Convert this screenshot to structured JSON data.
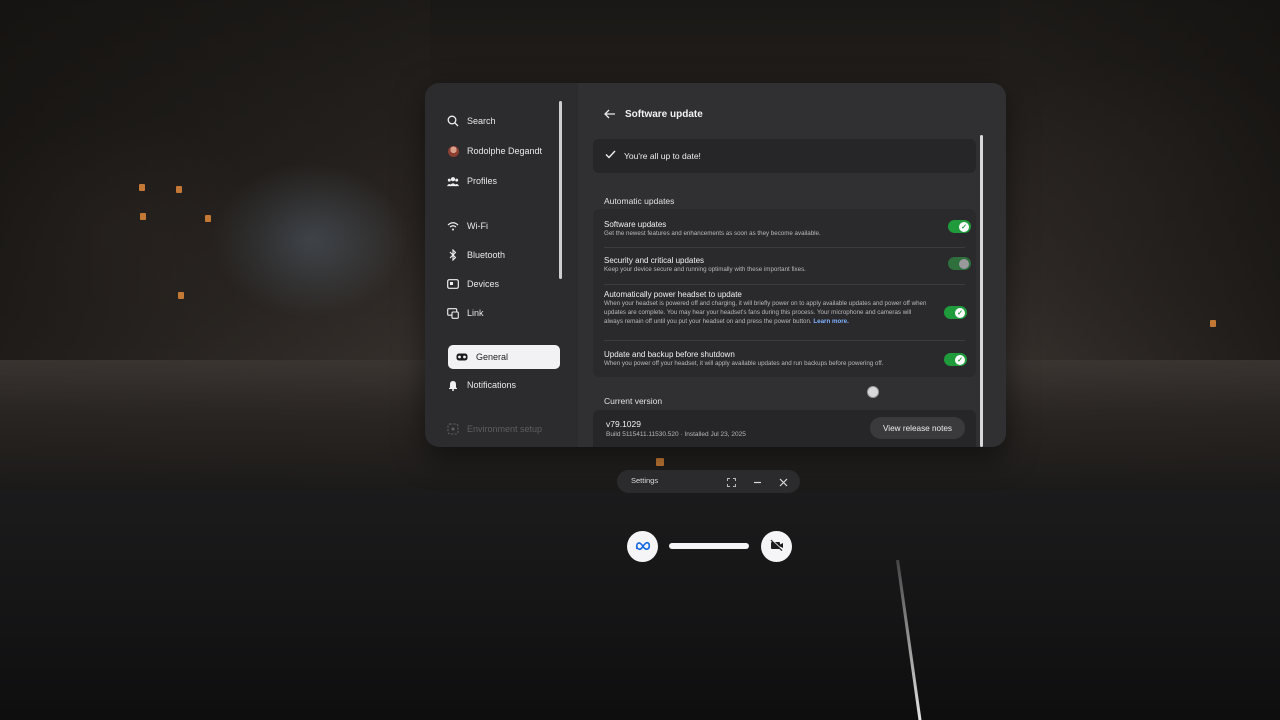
{
  "sidebar": {
    "items": [
      {
        "label": "Search",
        "icon": "search-icon"
      },
      {
        "label": "Rodolphe Degandt",
        "icon": "avatar"
      },
      {
        "label": "Profiles",
        "icon": "profiles-icon"
      },
      {
        "label": "Wi-Fi",
        "icon": "wifi-icon"
      },
      {
        "label": "Bluetooth",
        "icon": "bluetooth-icon"
      },
      {
        "label": "Devices",
        "icon": "devices-icon"
      },
      {
        "label": "Link",
        "icon": "link-icon"
      },
      {
        "label": "General",
        "icon": "headset-icon",
        "active": true
      },
      {
        "label": "Notifications",
        "icon": "bell-icon"
      },
      {
        "label": "Environment setup",
        "icon": "environment-icon",
        "disabled": true
      }
    ]
  },
  "main": {
    "title": "Software update",
    "status": "You're all up to date!",
    "automatic_label": "Automatic updates",
    "settings": [
      {
        "title": "Software updates",
        "desc": "Get the newest features and enhancements as soon as they become available.",
        "enabled": true
      },
      {
        "title": "Security and critical updates",
        "desc": "Keep your device secure and running optimally with these important fixes.",
        "enabled": true,
        "locked": true
      },
      {
        "title": "Automatically power headset to update",
        "desc": "When your headset is powered off and charging, it will briefly power on to apply available updates and power off when updates are complete. You may hear your headset's fans during this process. Your microphone and cameras will always remain off until you put your headset on and press the power button.",
        "link": "Learn more.",
        "enabled": true
      },
      {
        "title": "Update and backup before shutdown",
        "desc": "When you power off your headset, it will apply available updates and run backups before powering off.",
        "enabled": true
      }
    ],
    "current_version_label": "Current version",
    "version": "v79.1029",
    "build": "Build 5115411.11530.520 · Installed Jul 23, 2025",
    "release_notes_label": "View release notes"
  },
  "window_bar": {
    "title": "Settings"
  },
  "colors": {
    "toggle_on": "#1f9b3c",
    "panel_bg": "#2c2c2e",
    "link": "#7fb0ff"
  }
}
